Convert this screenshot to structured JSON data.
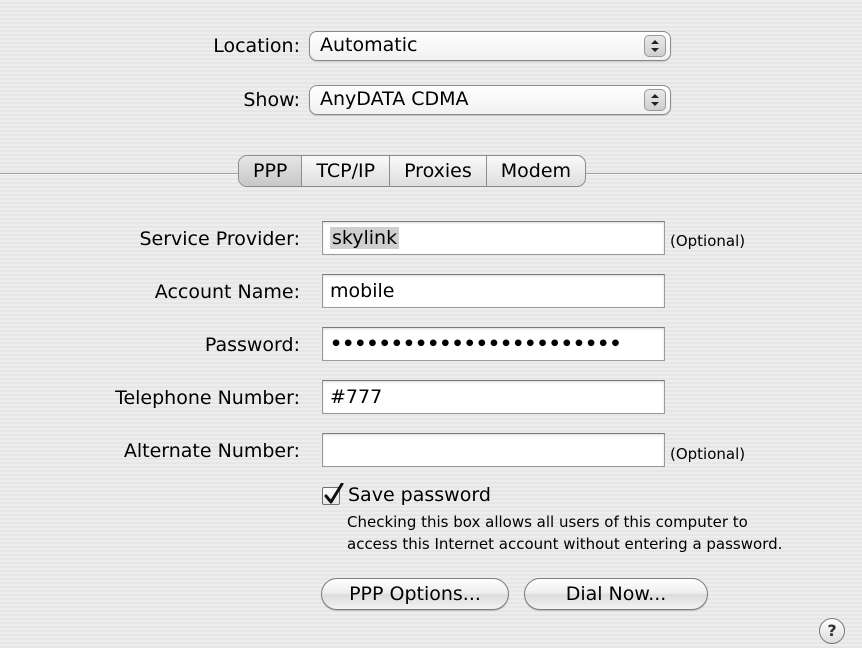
{
  "location": {
    "label": "Location:",
    "value": "Automatic"
  },
  "show": {
    "label": "Show:",
    "value": "AnyDATA CDMA"
  },
  "tabs": [
    {
      "label": "PPP"
    },
    {
      "label": "TCP/IP"
    },
    {
      "label": "Proxies"
    },
    {
      "label": "Modem"
    }
  ],
  "selected_tab": "PPP",
  "form": {
    "service_provider": {
      "label": "Service Provider:",
      "value": "skylink",
      "note": "(Optional)"
    },
    "account_name": {
      "label": "Account Name:",
      "value": "mobile"
    },
    "password": {
      "label": "Password:",
      "value": "••••••••••••••••••••••••"
    },
    "telephone_number": {
      "label": "Telephone Number:",
      "value": "#777"
    },
    "alternate_number": {
      "label": "Alternate Number:",
      "value": "",
      "note": "(Optional)"
    }
  },
  "save_password": {
    "label": "Save password",
    "checked": true,
    "note_line1": "Checking this box allows all users of this computer to",
    "note_line2": "access this Internet account without entering a password."
  },
  "buttons": {
    "ppp_options": "PPP Options...",
    "dial_now": "Dial Now..."
  },
  "help": {
    "glyph": "?",
    "icon": "help-icon"
  }
}
